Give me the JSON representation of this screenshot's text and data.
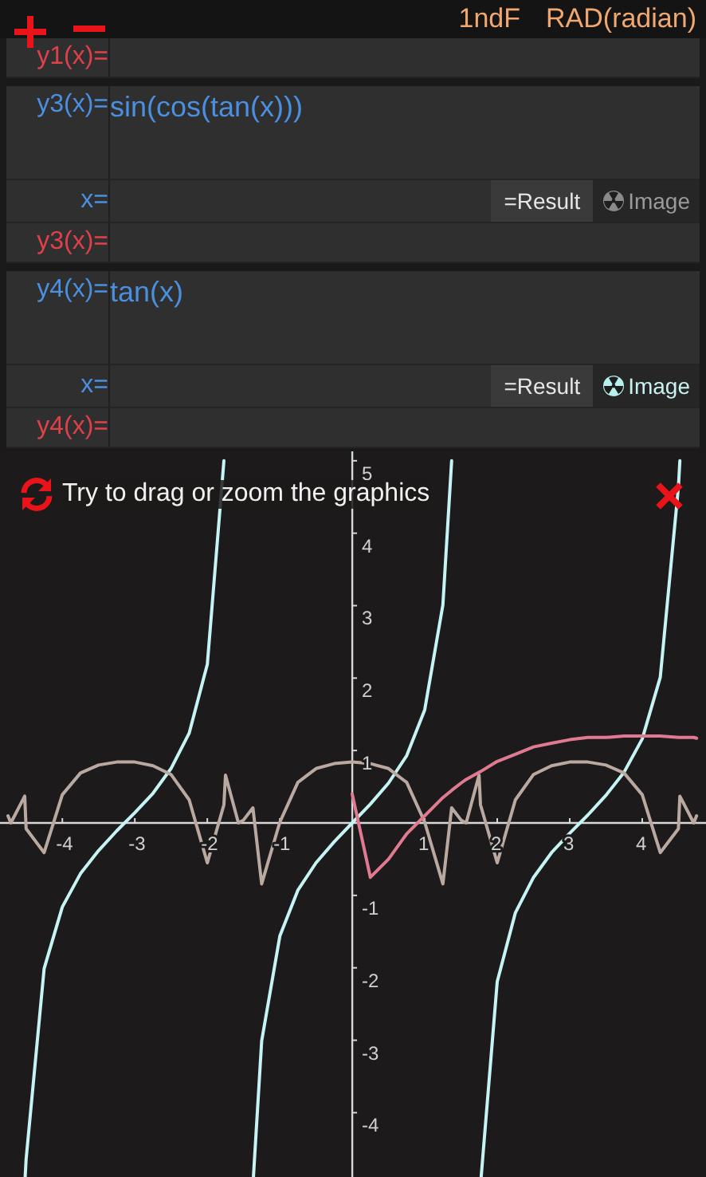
{
  "header": {
    "mode": "1ndF",
    "angle": "RAD(radian)"
  },
  "rows": [
    {
      "kind": "output",
      "label": "y1(x)="
    },
    {
      "kind": "input",
      "label": "y3(x)=",
      "value": "sin(cos(tan(x)))"
    },
    {
      "kind": "x",
      "label": "x=",
      "result_button": "=Result",
      "image_button": "Image",
      "image_on": false
    },
    {
      "kind": "output",
      "label": "y3(x)="
    },
    {
      "kind": "input",
      "label": "y4(x)=",
      "value": "tan(x)"
    },
    {
      "kind": "x",
      "label": "x=",
      "result_button": "=Result",
      "image_button": "Image",
      "image_on": true
    },
    {
      "kind": "output",
      "label": "y4(x)="
    }
  ],
  "graph": {
    "hint": "Try to drag or zoom the graphics",
    "chart_data": {
      "type": "line",
      "xlim": [
        -4.86,
        4.88
      ],
      "ylim": [
        -5.13,
        5.13
      ],
      "xticks": [
        -4,
        -3,
        -2,
        -1,
        1,
        2,
        3,
        4
      ],
      "yticks": [
        -4,
        -3,
        -2,
        -1,
        1,
        2,
        3,
        4,
        5
      ],
      "x": [
        -4.75,
        -4.71,
        -4.52,
        -4.5,
        -4.25,
        -4,
        -3.75,
        -3.5,
        -3.25,
        -3,
        -2.75,
        -2.5,
        -2.25,
        -2,
        -1.77,
        -1.75,
        -1.57,
        -1.5,
        -1.37,
        -1.25,
        -1,
        -0.75,
        -0.5,
        -0.25,
        0,
        0.25,
        0.5,
        0.75,
        1,
        1.25,
        1.37,
        1.5,
        1.57,
        1.75,
        1.77,
        2,
        2.25,
        2.5,
        2.75,
        3,
        3.25,
        3.5,
        3.75,
        4,
        4.25,
        4.5,
        4.52,
        4.71,
        4.75
      ],
      "series": [
        {
          "color": "#c6f3f3",
          "values": [
            null,
            null,
            -5,
            -4.64,
            -2.01,
            -1.16,
            -0.7,
            -0.38,
            -0.11,
            0.14,
            0.41,
            0.75,
            1.24,
            2.19,
            5,
            null,
            null,
            null,
            -5,
            -3.01,
            -1.56,
            -0.93,
            -0.55,
            -0.26,
            0,
            0.26,
            0.55,
            0.93,
            1.56,
            3.01,
            5,
            null,
            null,
            null,
            -5,
            -2.19,
            -1.24,
            -0.75,
            -0.41,
            -0.14,
            0.11,
            0.38,
            0.7,
            1.16,
            2.01,
            4.64,
            5,
            null,
            null
          ]
        },
        {
          "color": "#b9a9a1",
          "values": [
            0.1,
            0,
            0.37,
            -0.08,
            -0.41,
            0.39,
            0.69,
            0.8,
            0.84,
            0.84,
            0.79,
            0.67,
            0.32,
            -0.55,
            0.25,
            0.66,
            0,
            0.04,
            0.21,
            -0.84,
            0.01,
            0.56,
            0.75,
            0.82,
            0.84,
            0.82,
            0.75,
            0.56,
            0.01,
            -0.84,
            0.21,
            0.04,
            0,
            0.66,
            0.25,
            -0.55,
            0.32,
            0.67,
            0.79,
            0.84,
            0.84,
            0.8,
            0.69,
            0.39,
            -0.41,
            -0.08,
            0.37,
            0,
            0.1
          ]
        },
        {
          "color": "#e07a90",
          "values": [
            null,
            null,
            null,
            null,
            null,
            null,
            null,
            null,
            null,
            null,
            null,
            null,
            null,
            null,
            null,
            null,
            null,
            null,
            null,
            null,
            null,
            null,
            null,
            null,
            0.4,
            -0.75,
            -0.5,
            -0.15,
            0.1,
            0.35,
            0.45,
            0.55,
            0.6,
            0.7,
            0.71,
            0.85,
            0.95,
            1.05,
            1.1,
            1.15,
            1.18,
            1.18,
            1.2,
            1.2,
            1.2,
            1.18,
            1.18,
            1.18,
            1.17
          ]
        }
      ]
    }
  }
}
